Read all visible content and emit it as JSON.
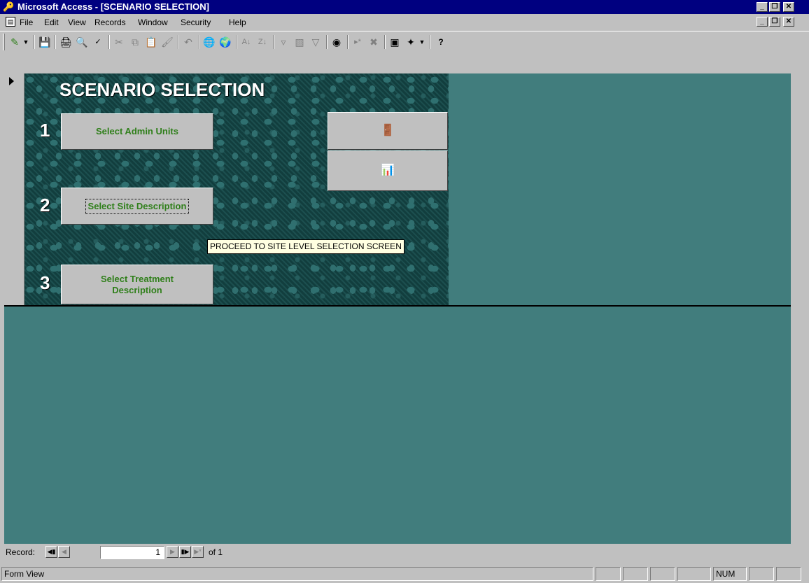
{
  "window": {
    "title": "Microsoft Access - [SCENARIO SELECTION]",
    "title_bg": "#000080"
  },
  "menu": {
    "items": [
      {
        "label": "File"
      },
      {
        "label": "Edit"
      },
      {
        "label": "View"
      },
      {
        "label": "Records"
      },
      {
        "label": "Window"
      },
      {
        "label": "Security"
      },
      {
        "label": "Help"
      }
    ]
  },
  "toolbar": {
    "icons": [
      "form-view-icon",
      "save-icon",
      "print-icon",
      "print-preview-icon",
      "spelling-icon",
      "cut-icon",
      "copy-icon",
      "paste-icon",
      "format-painter-icon",
      "undo-icon",
      "insert-hyperlink-icon",
      "web-toolbar-icon",
      "sort-ascending-icon",
      "sort-descending-icon",
      "filter-by-selection-icon",
      "filter-by-form-icon",
      "apply-filter-icon",
      "find-icon",
      "new-record-icon",
      "delete-record-icon",
      "database-window-icon",
      "new-object-icon",
      "help-icon"
    ]
  },
  "form": {
    "title": "SCENARIO SELECTION",
    "steps": [
      {
        "number": "1",
        "label": "Select Admin Units"
      },
      {
        "number": "2",
        "label": "Select Site Description"
      },
      {
        "number": "3",
        "label": "Select Treatment Description"
      }
    ],
    "side_buttons": [
      {
        "icon": "exit-door-icon"
      },
      {
        "icon": "report-chart-icon"
      }
    ],
    "tooltip": "PROCEED TO SITE LEVEL SELECTION SCREEN",
    "panel_color": "#123e3e",
    "button_text_color": "#2f7f1a",
    "background_color": "#417d7d"
  },
  "navigation": {
    "record_label": "Record:",
    "current_record": "1",
    "of_label": "of 1"
  },
  "status": {
    "mode": "Form View",
    "num_indicator": "NUM"
  }
}
